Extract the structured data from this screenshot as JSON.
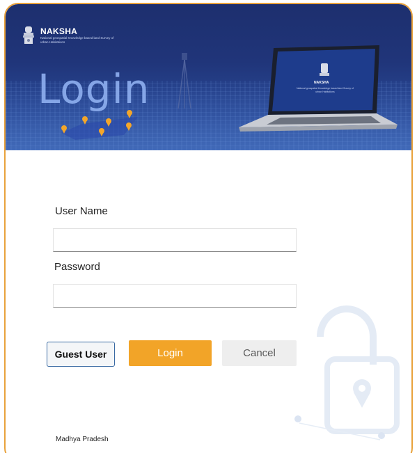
{
  "brand": {
    "title": "NAKSHA",
    "subtitle": "National geospatial Knowledge based land Survey of urban Habitations",
    "heading": "Login"
  },
  "laptop_screen": {
    "title": "NAKSHA",
    "subtitle": "National geospatial Knowledge based land Survey of urban Habitations"
  },
  "form": {
    "username_label": "User Name",
    "username_value": "",
    "password_label": "Password",
    "password_value": ""
  },
  "buttons": {
    "guest": "Guest User",
    "login": "Login",
    "cancel": "Cancel"
  },
  "footer": {
    "state": "Madhya Pradesh"
  },
  "colors": {
    "accent": "#f2a428",
    "frame_border": "#e9a23b",
    "banner": "#20357a"
  }
}
